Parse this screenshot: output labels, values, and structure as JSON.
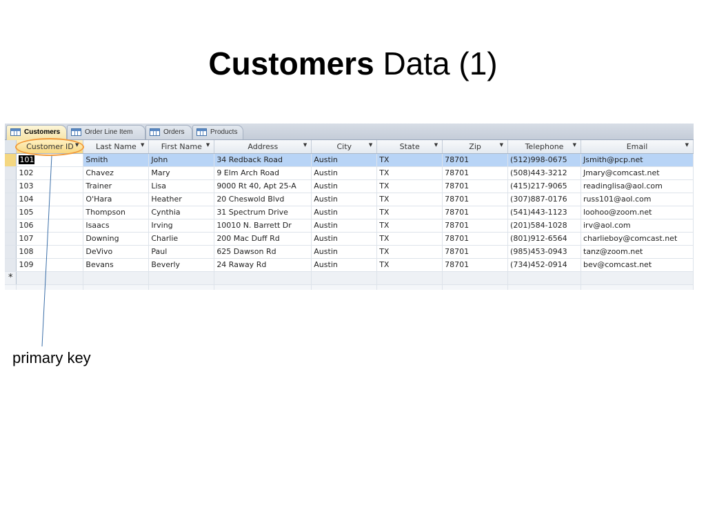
{
  "slide": {
    "title_bold": "Customers",
    "title_rest": " Data (1)",
    "callout": "primary key"
  },
  "tabs": [
    {
      "label": "Customers",
      "active": true
    },
    {
      "label": "Order Line Item",
      "active": false
    },
    {
      "label": "Orders",
      "active": false
    },
    {
      "label": "Products",
      "active": false
    }
  ],
  "columns": [
    "Customer ID",
    "Last Name",
    "First Name",
    "Address",
    "City",
    "State",
    "Zip",
    "Telephone",
    "Email"
  ],
  "rows": [
    [
      "101",
      "Smith",
      "John",
      "34 Redback Road",
      "Austin",
      "TX",
      "78701",
      "(512)998-0675",
      "Jsmith@pcp.net"
    ],
    [
      "102",
      "Chavez",
      "Mary",
      "9 Elm Arch Road",
      "Austin",
      "TX",
      "78701",
      "(508)443-3212",
      "Jmary@comcast.net"
    ],
    [
      "103",
      "Trainer",
      "Lisa",
      "9000 Rt 40, Apt 25-A",
      "Austin",
      "TX",
      "78701",
      "(415)217-9065",
      "readinglisa@aol.com"
    ],
    [
      "104",
      "O'Hara",
      "Heather",
      "20 Cheswold Blvd",
      "Austin",
      "TX",
      "78701",
      "(307)887-0176",
      "russ101@aol.com"
    ],
    [
      "105",
      "Thompson",
      "Cynthia",
      "31 Spectrum Drive",
      "Austin",
      "TX",
      "78701",
      "(541)443-1123",
      "loohoo@zoom.net"
    ],
    [
      "106",
      "Isaacs",
      "Irving",
      "10010 N. Barrett Dr",
      "Austin",
      "TX",
      "78701",
      "(201)584-1028",
      "irv@aol.com"
    ],
    [
      "107",
      "Downing",
      "Charlie",
      "200 Mac Duff Rd",
      "Austin",
      "TX",
      "78701",
      "(801)912-6564",
      "charlieboy@comcast.net"
    ],
    [
      "108",
      "DeVivo",
      "Paul",
      "625 Dawson Rd",
      "Austin",
      "TX",
      "78701",
      "(985)453-0943",
      "tanz@zoom.net"
    ],
    [
      "109",
      "Bevans",
      "Beverly",
      "24 Raway Rd",
      "Austin",
      "TX",
      "78701",
      "(734)452-0914",
      "bev@comcast.net"
    ]
  ],
  "new_row_marker": "*",
  "colors": {
    "selected_row": "#b8d4f6",
    "pk_header": "#f8d882",
    "callout_oval": "#f29a3a",
    "callout_line": "#3a6ea8"
  }
}
